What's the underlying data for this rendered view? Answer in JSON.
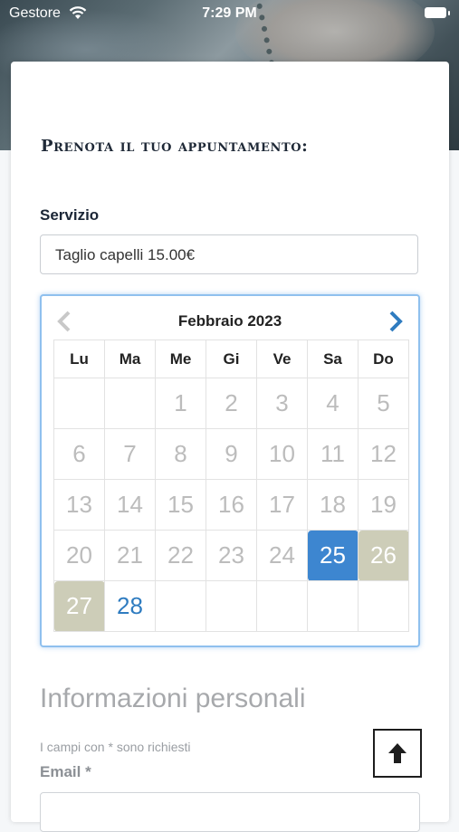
{
  "status_bar": {
    "carrier": "Gestore",
    "time": "7:29 PM"
  },
  "form": {
    "title": "Prenota il tuo appuntamento:",
    "service_label": "Servizio",
    "service_value": "Taglio capelli 15.00€"
  },
  "calendar": {
    "month_label": "Febbraio 2023",
    "weekdays": [
      "Lu",
      "Ma",
      "Me",
      "Gi",
      "Ve",
      "Sa",
      "Do"
    ],
    "weeks": [
      [
        "",
        "",
        "1",
        "2",
        "3",
        "4",
        "5"
      ],
      [
        "6",
        "7",
        "8",
        "9",
        "10",
        "11",
        "12"
      ],
      [
        "13",
        "14",
        "15",
        "16",
        "17",
        "18",
        "19"
      ],
      [
        "20",
        "21",
        "22",
        "23",
        "24",
        "25",
        "26"
      ],
      [
        "27",
        "28",
        "",
        "",
        "",
        "",
        ""
      ]
    ],
    "selected_day": "25",
    "highlighted_days": [
      "26",
      "27"
    ],
    "available_days": [
      "28"
    ],
    "colors": {
      "selected": "#3d86d0",
      "highlight": "#cdcdb8",
      "available": "#2f7cc0",
      "disabled": "#bcbcbc"
    }
  },
  "personal": {
    "heading": "Informazioni personali",
    "required_note": "I campi con * sono richiesti",
    "email_label": "Email *"
  },
  "icons": {
    "wifi": "wifi-icon",
    "battery": "battery-icon",
    "prev": "chevron-left-icon",
    "next": "chevron-right-icon",
    "scroll_top": "arrow-up-icon"
  }
}
